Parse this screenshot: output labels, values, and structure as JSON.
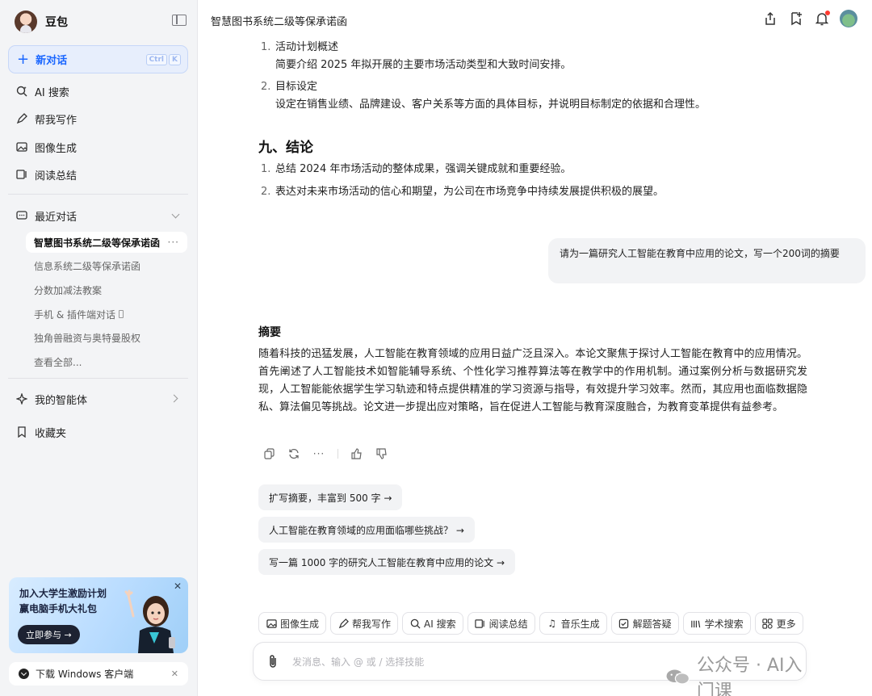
{
  "app": {
    "name": "豆包"
  },
  "sidebar": {
    "new_chat": {
      "label": "新对话",
      "shortcut": [
        "Ctrl",
        "K"
      ]
    },
    "nav": [
      {
        "label": "AI 搜索",
        "icon": "ai-search-icon"
      },
      {
        "label": "帮我写作",
        "icon": "pen-icon"
      },
      {
        "label": "图像生成",
        "icon": "image-icon"
      },
      {
        "label": "阅读总结",
        "icon": "read-icon"
      }
    ],
    "recent": {
      "label": "最近对话",
      "items": [
        {
          "label": "智慧图书系统二级等保承诺函",
          "active": true
        },
        {
          "label": "信息系统二级等保承诺函"
        },
        {
          "label": "分数加减法教案"
        },
        {
          "label": "手机 & 插件端对话"
        },
        {
          "label": "独角兽融资与奥特曼股权"
        },
        {
          "label": "查看全部..."
        }
      ]
    },
    "agents": {
      "label": "我的智能体"
    },
    "favorites": {
      "label": "收藏夹"
    },
    "promo": {
      "line1": "加入大学生激励计划",
      "line2": "赢电脑手机大礼包",
      "button": "立即参与 →"
    },
    "download": {
      "label": "下载 Windows 客户端"
    }
  },
  "header": {
    "title": "智慧图书系统二级等保承诺函"
  },
  "chat": {
    "prev_list": [
      {
        "num": "1.",
        "title": "活动计划概述",
        "desc": "简要介绍 2025 年拟开展的主要市场活动类型和大致时间安排。"
      },
      {
        "num": "2.",
        "title": "目标设定",
        "desc": "设定在销售业绩、品牌建设、客户关系等方面的具体目标，并说明目标制定的依据和合理性。"
      }
    ],
    "section_title": "九、结论",
    "conclusion": [
      {
        "num": "1.",
        "text": "总结 2024 年市场活动的整体成果，强调关键成就和重要经验。"
      },
      {
        "num": "2.",
        "text": "表达对未来市场活动的信心和期望，为公司在市场竞争中持续发展提供积极的展望。"
      }
    ],
    "user_message": "请为一篇研究人工智能在教育中应用的论文，写一个200词的摘要",
    "answer_title": "摘要",
    "answer_body": "随着科技的迅猛发展，人工智能在教育领域的应用日益广泛且深入。本论文聚焦于探讨人工智能在教育中的应用情况。首先阐述了人工智能技术如智能辅导系统、个性化学习推荐算法等在教学中的作用机制。通过案例分析与数据研究发现，人工智能能依据学生学习轨迹和特点提供精准的学习资源与指导，有效提升学习效率。然而，其应用也面临数据隐私、算法偏见等挑战。论文进一步提出应对策略，旨在促进人工智能与教育深度融合，为教育变革提供有益参考。",
    "suggestions": [
      "扩写摘要，丰富到 500 字 →",
      "人工智能在教育领域的应用面临哪些挑战？ →",
      "写一篇 1000 字的研究人工智能在教育中应用的论文 →"
    ]
  },
  "tools": [
    {
      "label": "图像生成",
      "icon": "image-icon"
    },
    {
      "label": "帮我写作",
      "icon": "pen-icon"
    },
    {
      "label": "AI 搜索",
      "icon": "ai-search-icon"
    },
    {
      "label": "阅读总结",
      "icon": "read-icon"
    },
    {
      "label": "音乐生成",
      "icon": "music-icon"
    },
    {
      "label": "解题答疑",
      "icon": "solve-icon"
    },
    {
      "label": "学术搜索",
      "icon": "academic-icon"
    },
    {
      "label": "更多",
      "icon": "more-grid-icon"
    }
  ],
  "composer": {
    "placeholder": "发消息、输入 @ 或 / 选择技能"
  },
  "watermark": {
    "text": "公众号 · AI入门课"
  }
}
